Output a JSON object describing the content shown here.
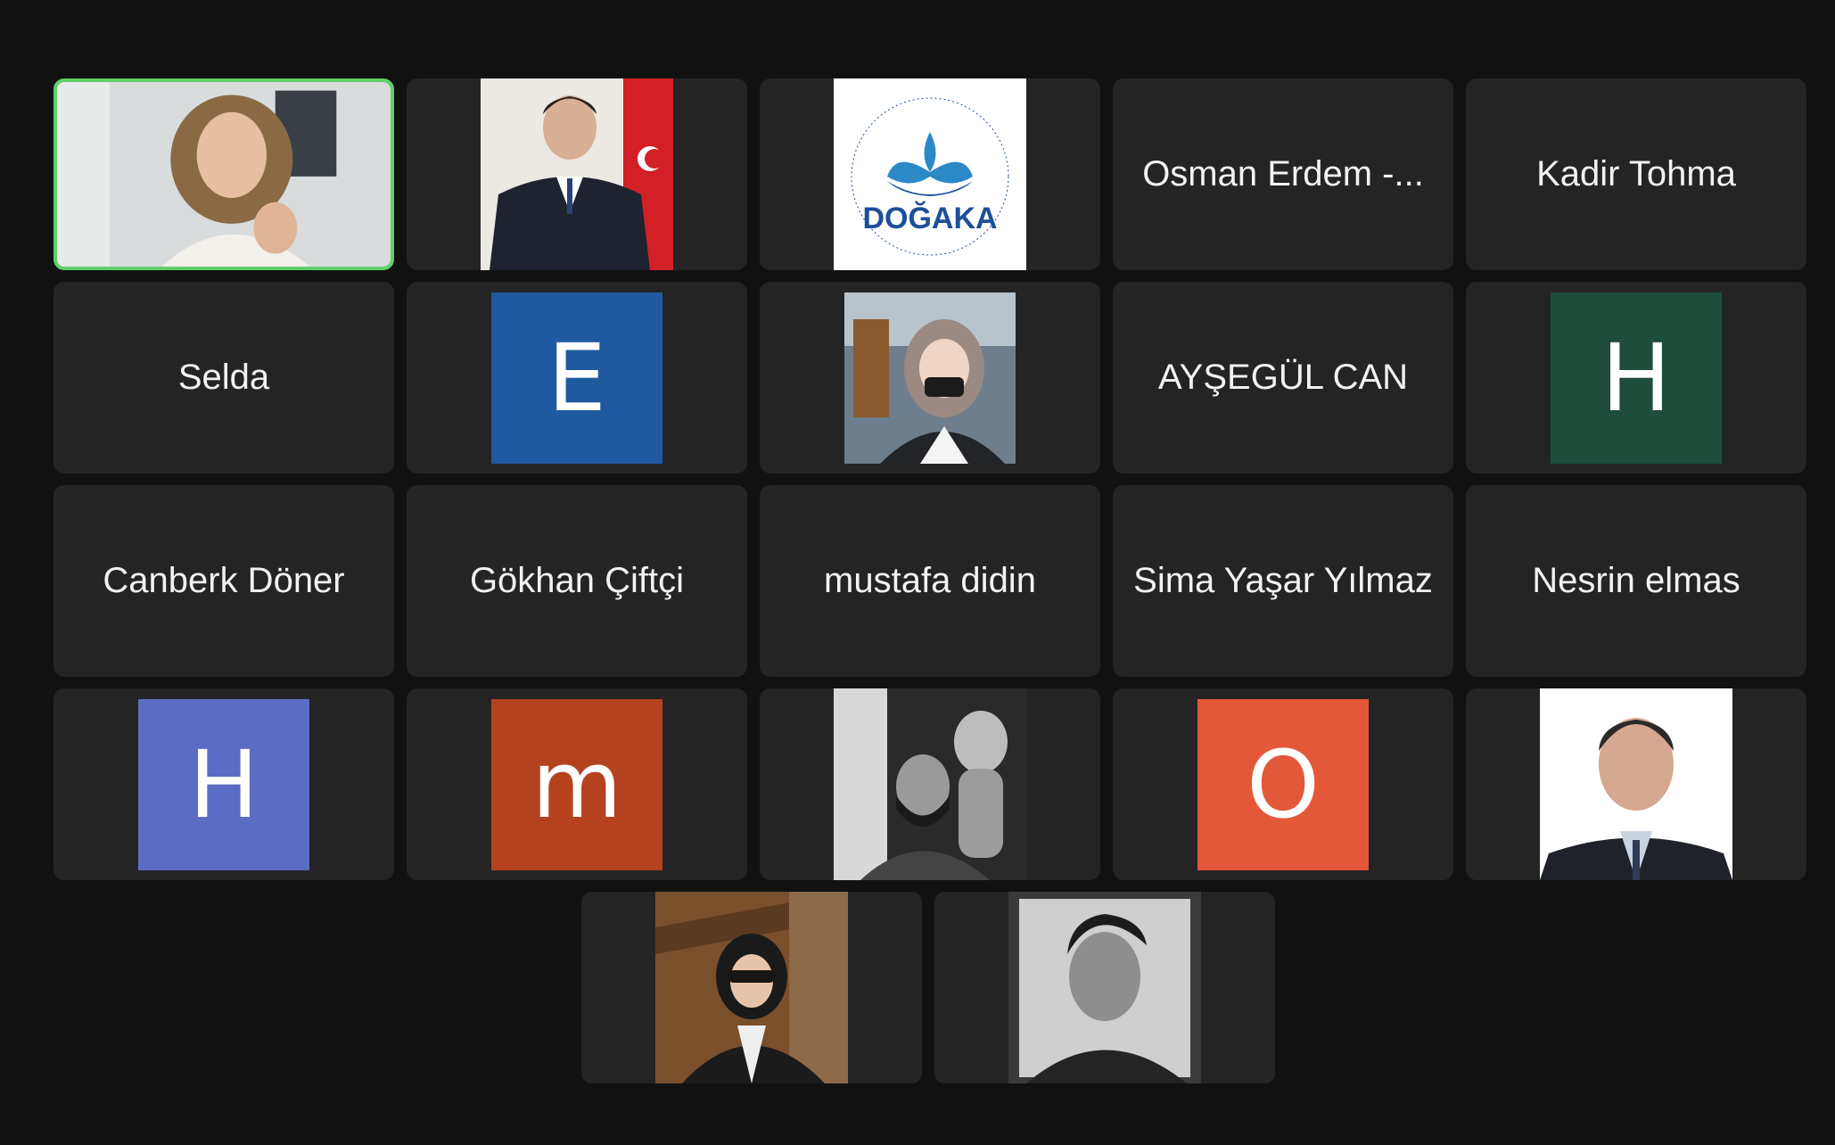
{
  "meeting": {
    "active_speaker_border": "#5fd068",
    "tile_background": "#242424",
    "page_background": "#111111"
  },
  "participants": {
    "p1": {
      "type": "video",
      "icon": "person-video"
    },
    "p2": {
      "type": "photo",
      "icon": "person-photo-flag"
    },
    "p3": {
      "type": "logo",
      "logo_text": "DOĞAKA",
      "logo_ring_text": "T.C. DOĞU AKDENİZ KALKINMA AJANSI • T.R. EASTERN MEDITERRANEAN DEVELOPMENT AGENCY"
    },
    "p4": {
      "type": "name",
      "name": "Osman Erdem -..."
    },
    "p5": {
      "type": "name",
      "name": "Kadir Tohma"
    },
    "p6": {
      "type": "name",
      "name": "Selda"
    },
    "p7": {
      "type": "avatar",
      "initial": "E",
      "color": "#1f5aa0"
    },
    "p8": {
      "type": "photo",
      "icon": "person-photo"
    },
    "p9": {
      "type": "name",
      "name": "AYŞEGÜL CAN"
    },
    "p10": {
      "type": "avatar",
      "initial": "H",
      "color": "#1e4d3c"
    },
    "p11": {
      "type": "name",
      "name": "Canberk Döner"
    },
    "p12": {
      "type": "name",
      "name": "Gökhan Çiftçi"
    },
    "p13": {
      "type": "name",
      "name": "mustafa didin"
    },
    "p14": {
      "type": "name",
      "name": "Sima Yaşar Yılmaz"
    },
    "p15": {
      "type": "name",
      "name": "Nesrin elmas"
    },
    "p16": {
      "type": "avatar",
      "initial": "H",
      "color": "#5b6cc4"
    },
    "p17": {
      "type": "avatar",
      "initial": "m",
      "color": "#b5421f"
    },
    "p18": {
      "type": "photo",
      "icon": "person-photo-bw"
    },
    "p19": {
      "type": "avatar",
      "initial": "O",
      "color": "#e4583a"
    },
    "p20": {
      "type": "photo",
      "icon": "person-photo"
    },
    "p21": {
      "type": "photo",
      "icon": "person-photo"
    },
    "p22": {
      "type": "photo",
      "icon": "person-photo-bw"
    }
  }
}
